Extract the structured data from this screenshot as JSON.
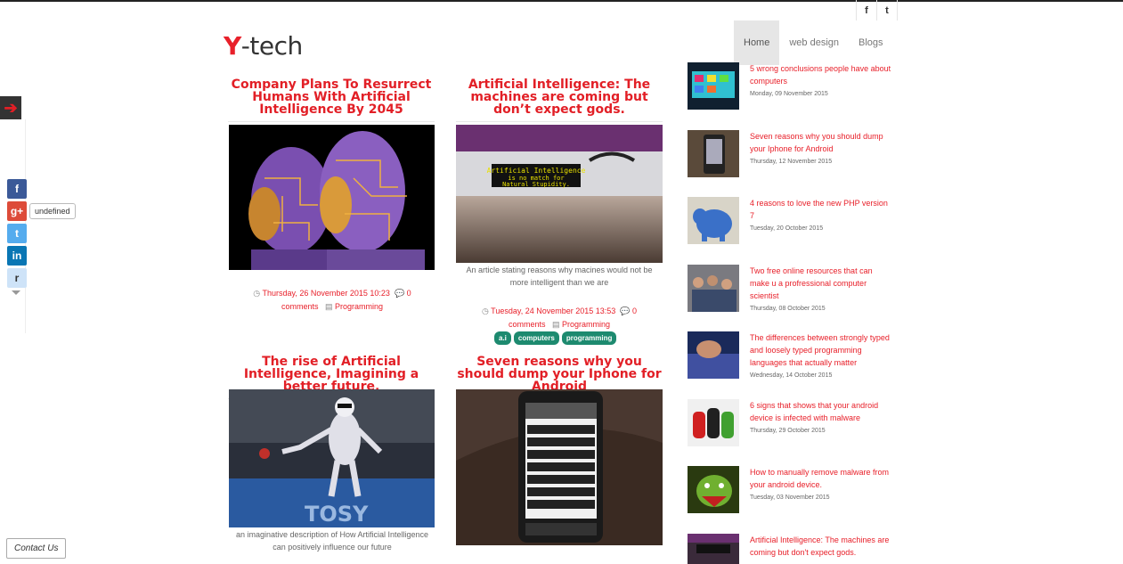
{
  "header": {
    "logo_letter": "Y",
    "logo_rest": "-tech",
    "social": [
      "f",
      "t"
    ],
    "nav": [
      "Home",
      "web design",
      "Blogs"
    ]
  },
  "posts": [
    {
      "title": "Company Plans To Resurrect Humans With Artificial Intelligence By 2045",
      "date": "Thursday, 26 November 2015 10:23",
      "comments": "0",
      "comments_label": "comments",
      "category": "Programming"
    },
    {
      "title": "Artificial Intelligence: The machines are coming but don’t expect gods.",
      "image_text": "Artificial Intelligence is no match for Natural Stupidity.",
      "caption": "An article stating reasons why macines would not be more intelligent than we are",
      "date": "Tuesday, 24 November 2015 13:53",
      "comments": "0",
      "comments_label": "comments",
      "category": "Programming",
      "tags": [
        "a.i",
        "computers",
        "programming"
      ]
    },
    {
      "title": "The rise of Artificial Intelligence, Imagining a better future.",
      "image_text": "TOSY",
      "caption": "an imaginative description of How Artificial Intelligence can positively influence our future"
    },
    {
      "title": "Seven reasons why you should dump your Iphone for Android"
    }
  ],
  "sidebar": [
    {
      "title": "5 wrong conclusions people have about computers",
      "date": "Monday, 09 November 2015"
    },
    {
      "title": "Seven reasons why you should dump your Iphone for Android",
      "date": "Thursday, 12 November 2015"
    },
    {
      "title": "4 reasons to love the new PHP version 7",
      "date": "Tuesday, 20 October 2015"
    },
    {
      "title": "Two free online resources that can make u a profressional computer scientist",
      "date": "Thursday, 08 October 2015"
    },
    {
      "title": "The differences between strongly typed and loosely typed programming languages that actually matter",
      "date": "Wednesday, 14 October 2015"
    },
    {
      "title": "6 signs that shows that your android device is infected with malware",
      "date": "Thursday, 29 October 2015"
    },
    {
      "title": "How to manually remove malware from your android device.",
      "date": "Tuesday, 03 November 2015"
    },
    {
      "title": "Artificial Intelligence: The machines are coming but don't expect gods."
    }
  ],
  "left_share": {
    "buttons": [
      "f",
      "g+",
      "t",
      "in",
      "r"
    ],
    "count_label": "undefined"
  },
  "contact_label": "Contact Us",
  "colors": {
    "accent": "#e21f26",
    "tag": "#1d8a6f"
  }
}
